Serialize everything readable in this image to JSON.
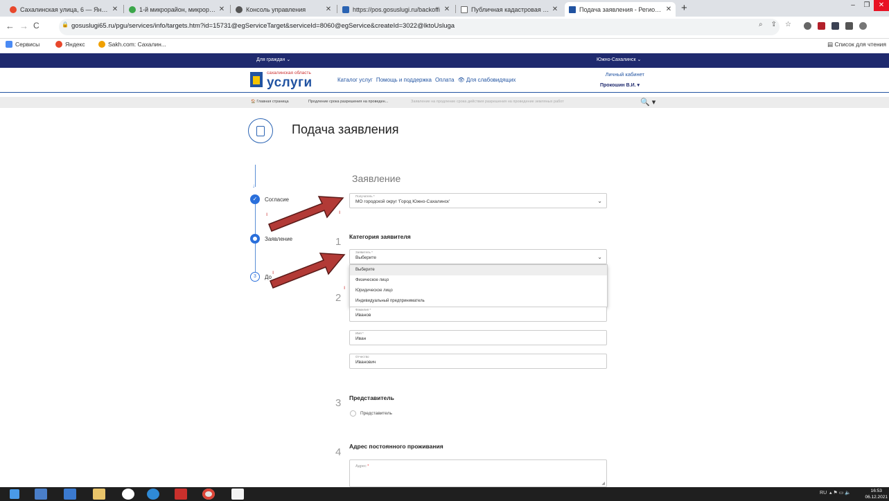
{
  "browser": {
    "tabs": [
      {
        "title": "Сахалинская улица, 6 — Яндекс",
        "icon": "map-pin-icon",
        "color": "#e8472b"
      },
      {
        "title": "1-й микрорайон, микрорайон",
        "icon": "location-icon",
        "color": "#3ba64a"
      },
      {
        "title": "Консоль управления",
        "icon": "globe-icon",
        "color": "#555555"
      },
      {
        "title": "https://pos.gosuslugi.ru/backoffi",
        "icon": "gosuslugi-icon",
        "color": "#2a63b3"
      },
      {
        "title": "Публичная кадастровая карта",
        "icon": "document-icon",
        "color": "#666666"
      },
      {
        "title": "Подача заявления - Региональ",
        "icon": "emblem-icon",
        "color": "#2153a1"
      }
    ],
    "active_tab": 5,
    "new_tab_symbol": "+",
    "url": "gosuslugi65.ru/pgu/services/info/targets.htm?id=15731@egServiceTarget&serviceId=8060@egService&createId=3022@lktoUsluga",
    "bookmarks": [
      {
        "label": "Сервисы",
        "icon": "apps-icon",
        "color": "#4a8af4"
      },
      {
        "label": "Яндекс",
        "icon": "yandex-icon",
        "color": "#e8472b"
      },
      {
        "label": "Sakh.com: Сахалин...",
        "icon": "sakh-icon",
        "color": "#f0a000"
      }
    ],
    "reading_list": "Список для чтения"
  },
  "site": {
    "for_citizens": "Для граждан ⌄",
    "region": "Южно-Сахалинск ⌄",
    "logo_small": "сахалинская область",
    "logo_main": "услуги",
    "nav": [
      "Каталог услуг",
      "Помощь и поддержка",
      "Оплата",
      "👁 Для слабовидящих"
    ],
    "cabinet": "Личный кабинет",
    "user": "Прокошин В.И. ▾",
    "breadcrumbs": [
      "🏠 Главная страница",
      "Продление срока разрешения на проведен...",
      "Заявление на продление срока действия разрешения на проведение земляных работ"
    ],
    "search_symbol": "🔍 ▾"
  },
  "page": {
    "title": "Подача заявления",
    "steps": [
      {
        "label": "Согласие",
        "state": "done"
      },
      {
        "label": "Заявление",
        "state": "current"
      },
      {
        "label": "До",
        "number": "3",
        "state": "pending"
      }
    ],
    "section_title": "Заявление",
    "recipient": {
      "caption": "Получатель *",
      "value": "МО городской округ 'Город Южно-Сахалинск'"
    },
    "category": {
      "number": "1",
      "title": "Категория заявителя",
      "caption": "Заявитель *",
      "value": "Выберите",
      "options": [
        "Выберите",
        "Физическое лицо",
        "Юридическое лицо",
        "Индивидуальный предприниматель"
      ]
    },
    "person": {
      "number": "2",
      "surname": {
        "caption": "Фамилия *",
        "value": "Иванов"
      },
      "name": {
        "caption": "Имя *",
        "value": "Иван"
      },
      "patronymic": {
        "caption": "Отчество",
        "value": "Иванович"
      }
    },
    "representative": {
      "number": "3",
      "title": "Представитель",
      "checkbox_label": "Представитель"
    },
    "address": {
      "number": "4",
      "title": "Адрес постоянного проживания",
      "placeholder": "Адрес",
      "required_mark": "*"
    }
  },
  "taskbar": {
    "lang": "RU",
    "tray": "▴  ⚑  ▭  🔈",
    "time": "16:53",
    "date": "06.12.2021"
  }
}
